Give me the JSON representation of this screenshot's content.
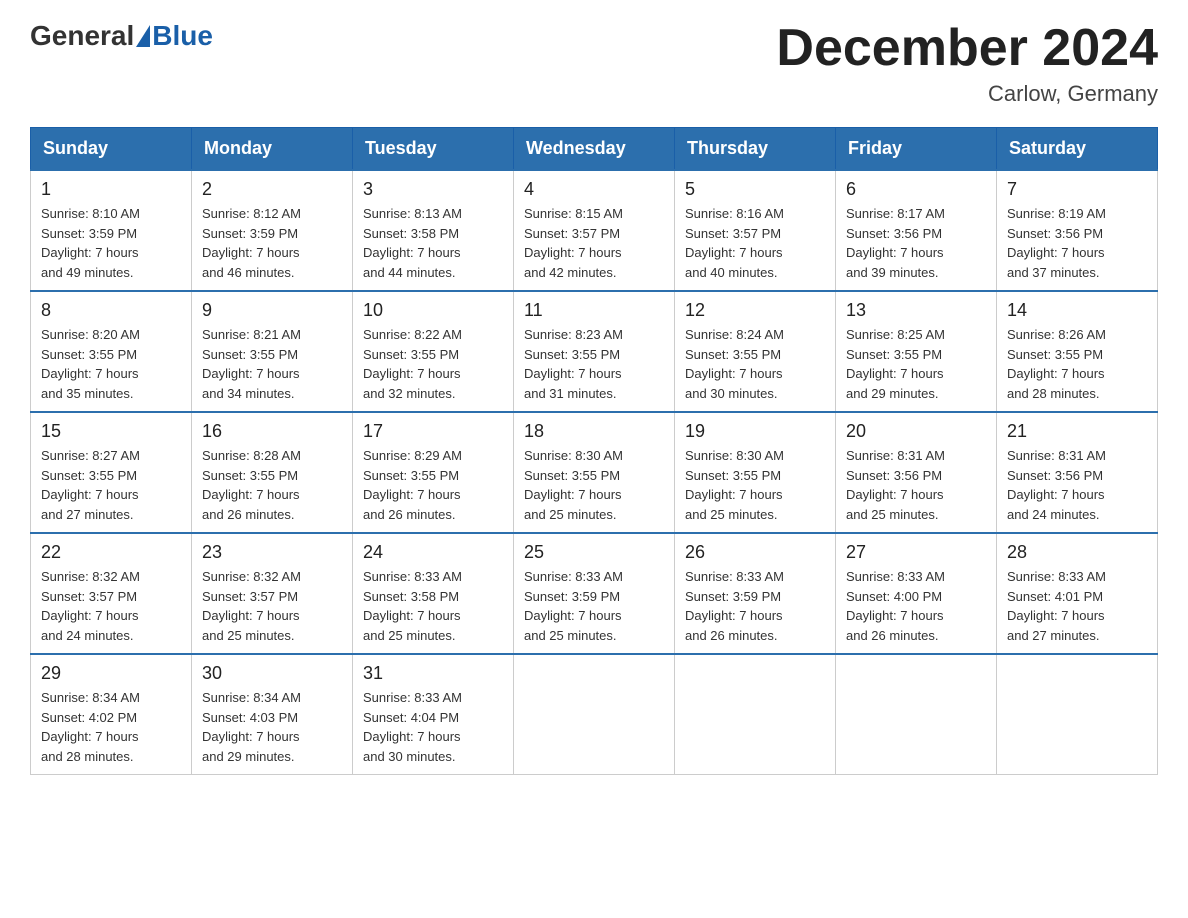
{
  "header": {
    "logo_general": "General",
    "logo_blue": "Blue",
    "month_title": "December 2024",
    "location": "Carlow, Germany"
  },
  "days_of_week": [
    "Sunday",
    "Monday",
    "Tuesday",
    "Wednesday",
    "Thursday",
    "Friday",
    "Saturday"
  ],
  "weeks": [
    [
      {
        "day": "1",
        "sunrise": "8:10 AM",
        "sunset": "3:59 PM",
        "daylight": "7 hours and 49 minutes."
      },
      {
        "day": "2",
        "sunrise": "8:12 AM",
        "sunset": "3:59 PM",
        "daylight": "7 hours and 46 minutes."
      },
      {
        "day": "3",
        "sunrise": "8:13 AM",
        "sunset": "3:58 PM",
        "daylight": "7 hours and 44 minutes."
      },
      {
        "day": "4",
        "sunrise": "8:15 AM",
        "sunset": "3:57 PM",
        "daylight": "7 hours and 42 minutes."
      },
      {
        "day": "5",
        "sunrise": "8:16 AM",
        "sunset": "3:57 PM",
        "daylight": "7 hours and 40 minutes."
      },
      {
        "day": "6",
        "sunrise": "8:17 AM",
        "sunset": "3:56 PM",
        "daylight": "7 hours and 39 minutes."
      },
      {
        "day": "7",
        "sunrise": "8:19 AM",
        "sunset": "3:56 PM",
        "daylight": "7 hours and 37 minutes."
      }
    ],
    [
      {
        "day": "8",
        "sunrise": "8:20 AM",
        "sunset": "3:55 PM",
        "daylight": "7 hours and 35 minutes."
      },
      {
        "day": "9",
        "sunrise": "8:21 AM",
        "sunset": "3:55 PM",
        "daylight": "7 hours and 34 minutes."
      },
      {
        "day": "10",
        "sunrise": "8:22 AM",
        "sunset": "3:55 PM",
        "daylight": "7 hours and 32 minutes."
      },
      {
        "day": "11",
        "sunrise": "8:23 AM",
        "sunset": "3:55 PM",
        "daylight": "7 hours and 31 minutes."
      },
      {
        "day": "12",
        "sunrise": "8:24 AM",
        "sunset": "3:55 PM",
        "daylight": "7 hours and 30 minutes."
      },
      {
        "day": "13",
        "sunrise": "8:25 AM",
        "sunset": "3:55 PM",
        "daylight": "7 hours and 29 minutes."
      },
      {
        "day": "14",
        "sunrise": "8:26 AM",
        "sunset": "3:55 PM",
        "daylight": "7 hours and 28 minutes."
      }
    ],
    [
      {
        "day": "15",
        "sunrise": "8:27 AM",
        "sunset": "3:55 PM",
        "daylight": "7 hours and 27 minutes."
      },
      {
        "day": "16",
        "sunrise": "8:28 AM",
        "sunset": "3:55 PM",
        "daylight": "7 hours and 26 minutes."
      },
      {
        "day": "17",
        "sunrise": "8:29 AM",
        "sunset": "3:55 PM",
        "daylight": "7 hours and 26 minutes."
      },
      {
        "day": "18",
        "sunrise": "8:30 AM",
        "sunset": "3:55 PM",
        "daylight": "7 hours and 25 minutes."
      },
      {
        "day": "19",
        "sunrise": "8:30 AM",
        "sunset": "3:55 PM",
        "daylight": "7 hours and 25 minutes."
      },
      {
        "day": "20",
        "sunrise": "8:31 AM",
        "sunset": "3:56 PM",
        "daylight": "7 hours and 25 minutes."
      },
      {
        "day": "21",
        "sunrise": "8:31 AM",
        "sunset": "3:56 PM",
        "daylight": "7 hours and 24 minutes."
      }
    ],
    [
      {
        "day": "22",
        "sunrise": "8:32 AM",
        "sunset": "3:57 PM",
        "daylight": "7 hours and 24 minutes."
      },
      {
        "day": "23",
        "sunrise": "8:32 AM",
        "sunset": "3:57 PM",
        "daylight": "7 hours and 25 minutes."
      },
      {
        "day": "24",
        "sunrise": "8:33 AM",
        "sunset": "3:58 PM",
        "daylight": "7 hours and 25 minutes."
      },
      {
        "day": "25",
        "sunrise": "8:33 AM",
        "sunset": "3:59 PM",
        "daylight": "7 hours and 25 minutes."
      },
      {
        "day": "26",
        "sunrise": "8:33 AM",
        "sunset": "3:59 PM",
        "daylight": "7 hours and 26 minutes."
      },
      {
        "day": "27",
        "sunrise": "8:33 AM",
        "sunset": "4:00 PM",
        "daylight": "7 hours and 26 minutes."
      },
      {
        "day": "28",
        "sunrise": "8:33 AM",
        "sunset": "4:01 PM",
        "daylight": "7 hours and 27 minutes."
      }
    ],
    [
      {
        "day": "29",
        "sunrise": "8:34 AM",
        "sunset": "4:02 PM",
        "daylight": "7 hours and 28 minutes."
      },
      {
        "day": "30",
        "sunrise": "8:34 AM",
        "sunset": "4:03 PM",
        "daylight": "7 hours and 29 minutes."
      },
      {
        "day": "31",
        "sunrise": "8:33 AM",
        "sunset": "4:04 PM",
        "daylight": "7 hours and 30 minutes."
      },
      null,
      null,
      null,
      null
    ]
  ],
  "labels": {
    "sunrise_prefix": "Sunrise: ",
    "sunset_prefix": "Sunset: ",
    "daylight_prefix": "Daylight: "
  }
}
